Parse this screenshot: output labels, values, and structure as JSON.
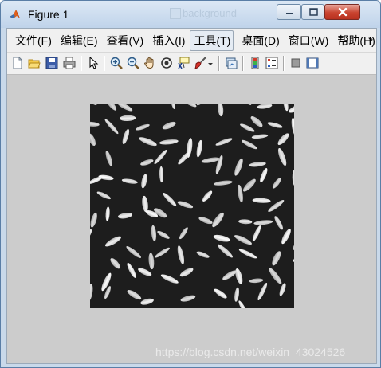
{
  "window": {
    "title": "Figure 1",
    "background_ghost_text": "background",
    "controls": {
      "minimize": "minimize",
      "maximize": "maximize",
      "close": "close"
    }
  },
  "menubar": {
    "items": [
      "文件(F)",
      "编辑(E)",
      "查看(V)",
      "插入(I)",
      "工具(T)",
      "桌面(D)",
      "窗口(W)",
      "帮助(H)"
    ],
    "active_item": "工具(T)",
    "overflow_glyph": "»"
  },
  "toolbar": {
    "buttons": [
      "new-figure-icon",
      "open-file-icon",
      "save-icon",
      "print-icon",
      "pointer-icon",
      "zoom-in-icon",
      "zoom-out-icon",
      "pan-hand-icon",
      "rotate-3d-icon",
      "data-cursor-icon",
      "brush-icon",
      "brush-dropdown-icon",
      "link-plot-icon",
      "colorbar-icon",
      "legend-icon",
      "hide-plot-tools-icon",
      "show-plot-tools-icon"
    ]
  },
  "figure": {
    "image_content": "rice-grains-grayscale",
    "background_color": "#cccccc",
    "image_background": "#1e1e1e"
  },
  "watermark": "https://blog.csdn.net/weixin_43024526",
  "colors": {
    "title_bar": "#c9d9ea",
    "close_button": "#c9432f",
    "menu_bg": "#f0f0f0"
  }
}
